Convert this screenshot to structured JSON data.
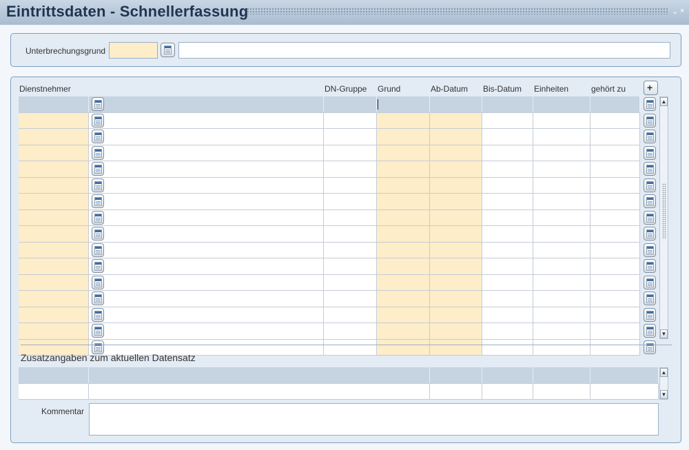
{
  "window": {
    "title": "Eintrittsdaten - Schnellerfassung",
    "controls": [
      "minimize-icon",
      "close-icon"
    ],
    "control_glyphs": [
      "⌄",
      "×"
    ]
  },
  "interruption": {
    "label": "Unterbrechungsgrund",
    "code_value": "",
    "description_value": ""
  },
  "grid": {
    "columns": [
      "Dienstnehmer",
      "DN-Gruppe",
      "Grund",
      "Ab-Datum",
      "Bis-Datum",
      "Einheiten",
      "gehört zu"
    ],
    "row_count": 15,
    "rows": [
      [
        "",
        "",
        "",
        "",
        "",
        "",
        "",
        ""
      ],
      [
        "",
        "",
        "",
        "",
        "",
        "",
        "",
        ""
      ],
      [
        "",
        "",
        "",
        "",
        "",
        "",
        "",
        ""
      ],
      [
        "",
        "",
        "",
        "",
        "",
        "",
        "",
        ""
      ],
      [
        "",
        "",
        "",
        "",
        "",
        "",
        "",
        ""
      ],
      [
        "",
        "",
        "",
        "",
        "",
        "",
        "",
        ""
      ],
      [
        "",
        "",
        "",
        "",
        "",
        "",
        "",
        ""
      ],
      [
        "",
        "",
        "",
        "",
        "",
        "",
        "",
        ""
      ],
      [
        "",
        "",
        "",
        "",
        "",
        "",
        "",
        ""
      ],
      [
        "",
        "",
        "",
        "",
        "",
        "",
        "",
        ""
      ],
      [
        "",
        "",
        "",
        "",
        "",
        "",
        "",
        ""
      ],
      [
        "",
        "",
        "",
        "",
        "",
        "",
        "",
        ""
      ],
      [
        "",
        "",
        "",
        "",
        "",
        "",
        "",
        ""
      ],
      [
        "",
        "",
        "",
        "",
        "",
        "",
        "",
        ""
      ],
      [
        "",
        "",
        "",
        "",
        "",
        "",
        "",
        ""
      ]
    ]
  },
  "details": {
    "title": "Zusatzangaben zum aktuellen Datensatz",
    "comment_label": "Kommentar",
    "comment_value": ""
  },
  "colors": {
    "required_field": "#fdedc8",
    "panel_border": "#7f9dbd",
    "header_row": "#c6d3e1",
    "title_text": "#1f3450"
  }
}
